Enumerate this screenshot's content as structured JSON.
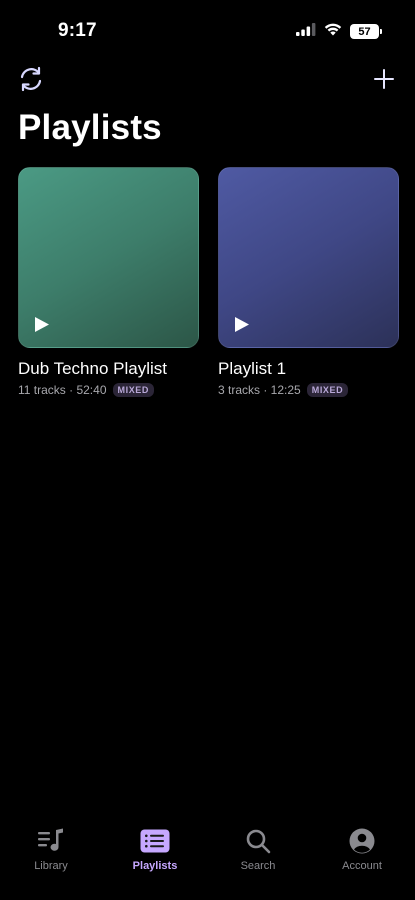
{
  "status_bar": {
    "time": "9:17",
    "battery": "57"
  },
  "toolbar": {
    "sync_icon": "sync-icon",
    "add_icon": "plus-icon"
  },
  "page_title": "Playlists",
  "playlists": [
    {
      "title": "Dub Techno Playlist",
      "meta": "11 tracks · 52:40",
      "badge": "MIXED",
      "color": "#3d7d6a"
    },
    {
      "title": "Playlist 1",
      "meta": "3 tracks · 12:25",
      "badge": "MIXED",
      "color": "#3f4785"
    }
  ],
  "tabs": [
    {
      "label": "Library",
      "icon": "library-icon",
      "active": false
    },
    {
      "label": "Playlists",
      "icon": "playlists-icon",
      "active": true
    },
    {
      "label": "Search",
      "icon": "search-icon",
      "active": false
    },
    {
      "label": "Account",
      "icon": "account-icon",
      "active": false
    }
  ],
  "colors": {
    "accent": "#c6a8ff",
    "background": "#000000",
    "inactive_tab": "#8a8a8f"
  }
}
